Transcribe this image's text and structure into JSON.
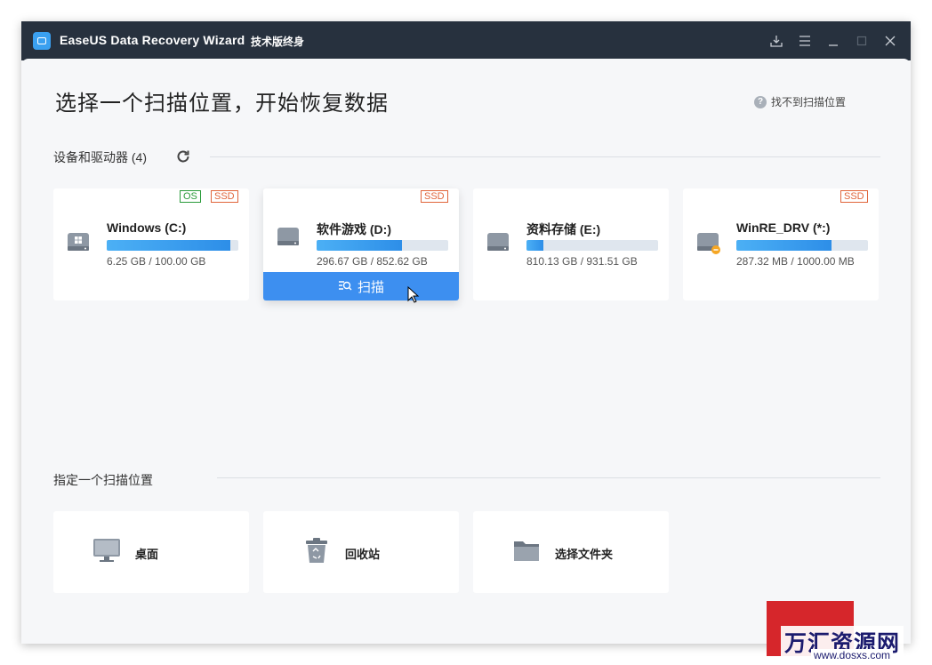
{
  "window": {
    "title": "EaseUS Data Recovery Wizard",
    "edition": "技术版终身"
  },
  "header": {
    "title": "选择一个扫描位置，开始恢复数据",
    "help_link": "找不到扫描位置"
  },
  "drives_section": {
    "label": "设备和驱动器 (4)",
    "drives": [
      {
        "name": "Windows (C:)",
        "size_text": "6.25 GB / 100.00 GB",
        "badges": [
          "OS",
          "SSD"
        ],
        "usage_fraction": 0.94,
        "icon": "windows-drive-icon"
      },
      {
        "name": "软件游戏 (D:)",
        "size_text": "296.67 GB / 852.62 GB",
        "badges": [
          "SSD"
        ],
        "usage_fraction": 0.65,
        "icon": "hard-drive-icon"
      },
      {
        "name": "资料存储 (E:)",
        "size_text": "810.13 GB / 931.51 GB",
        "badges": [],
        "usage_fraction": 0.13,
        "icon": "hard-drive-icon"
      },
      {
        "name": "WinRE_DRV (*:)",
        "size_text": "287.32 MB / 1000.00 MB",
        "badges": [
          "SSD"
        ],
        "usage_fraction": 0.72,
        "icon": "hidden-drive-icon"
      }
    ],
    "scan_button": "扫描"
  },
  "locations_section": {
    "label": "指定一个扫描位置",
    "items": [
      {
        "label": "桌面",
        "icon": "desktop-icon"
      },
      {
        "label": "回收站",
        "icon": "recycle-bin-icon"
      },
      {
        "label": "选择文件夹",
        "icon": "folder-icon"
      }
    ]
  },
  "watermark": {
    "text": "万汇资源网",
    "url": "www.dosxs.com"
  },
  "colors": {
    "titlebar": "#27313e",
    "accent": "#3d8ff0",
    "os_badge": "#2a9b3a",
    "ssd_badge": "#e0643a",
    "watermark_red": "#d6262b"
  }
}
